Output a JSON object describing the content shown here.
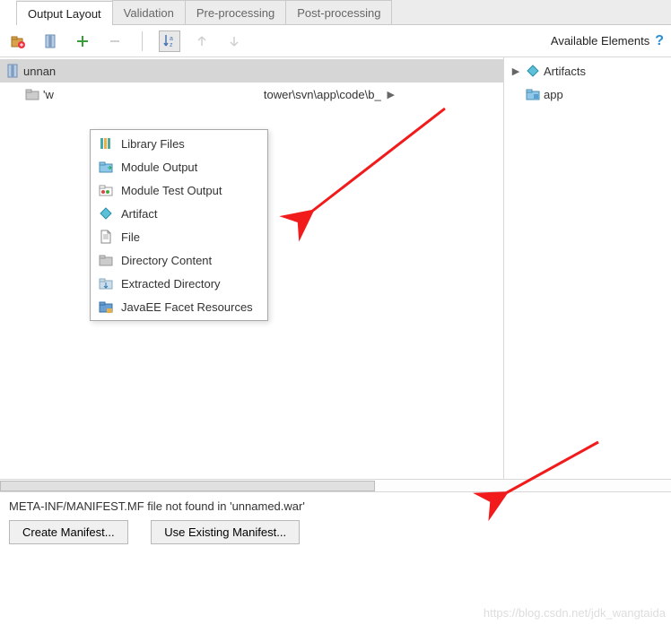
{
  "tabs": {
    "items": [
      {
        "label": "Output Layout",
        "active": true
      },
      {
        "label": "Validation",
        "active": false
      },
      {
        "label": "Pre-processing",
        "active": false
      },
      {
        "label": "Post-processing",
        "active": false
      }
    ]
  },
  "toolbar": {
    "available_label": "Available Elements",
    "icons": {
      "new_folder": "new-folder-icon",
      "jar": "archive-icon",
      "add": "add-icon",
      "remove": "remove-icon",
      "sort": "sort-az-icon",
      "up": "arrow-up-icon",
      "down": "arrow-down-icon"
    }
  },
  "left_tree": {
    "root": {
      "label": "unnan",
      "icon": "archive-icon"
    },
    "child": {
      "prefix": "'w",
      "path_tail": "tower\\svn\\app\\code\\b_",
      "icon": "folder-icon"
    }
  },
  "popup": {
    "items": [
      {
        "label": "Library Files",
        "icon": "library-icon"
      },
      {
        "label": "Module Output",
        "icon": "module-output-icon"
      },
      {
        "label": "Module Test Output",
        "icon": "module-test-output-icon"
      },
      {
        "label": "Artifact",
        "icon": "artifact-icon"
      },
      {
        "label": "File",
        "icon": "file-icon"
      },
      {
        "label": "Directory Content",
        "icon": "folder-icon"
      },
      {
        "label": "Extracted Directory",
        "icon": "extracted-dir-icon"
      },
      {
        "label": "JavaEE Facet Resources",
        "icon": "javaee-facet-icon"
      }
    ]
  },
  "right_tree": {
    "root": {
      "label": "Artifacts",
      "icon": "artifact-icon"
    },
    "child": {
      "label": "app",
      "icon": "module-folder-icon"
    }
  },
  "bottom": {
    "message": "META-INF/MANIFEST.MF file not found in 'unnamed.war'",
    "create_label": "Create Manifest...",
    "use_label": "Use Existing Manifest..."
  },
  "watermark": "https://blog.csdn.net/jdk_wangtaida"
}
